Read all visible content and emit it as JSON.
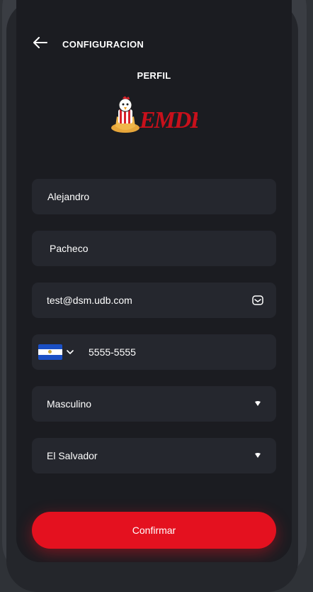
{
  "header": {
    "title": "CONFIGURACION",
    "back_icon": "arrow-left-icon"
  },
  "section": {
    "title": "PERFIL"
  },
  "logo": {
    "text": "EMDB",
    "icon": "chicken-popcorn-logo"
  },
  "form": {
    "first_name": "Alejandro",
    "last_name": "Pacheco",
    "email": "test@dsm.udb.com",
    "email_icon": "email-icon",
    "phone_flag": "el-salvador-flag-icon",
    "phone": "5555-5555",
    "gender": "Masculino",
    "country": "El Salvador"
  },
  "confirm_label": "Confirmar",
  "colors": {
    "background": "#1b1c21",
    "field": "#25272e",
    "accent": "#e4111f",
    "text": "#ffffff"
  }
}
